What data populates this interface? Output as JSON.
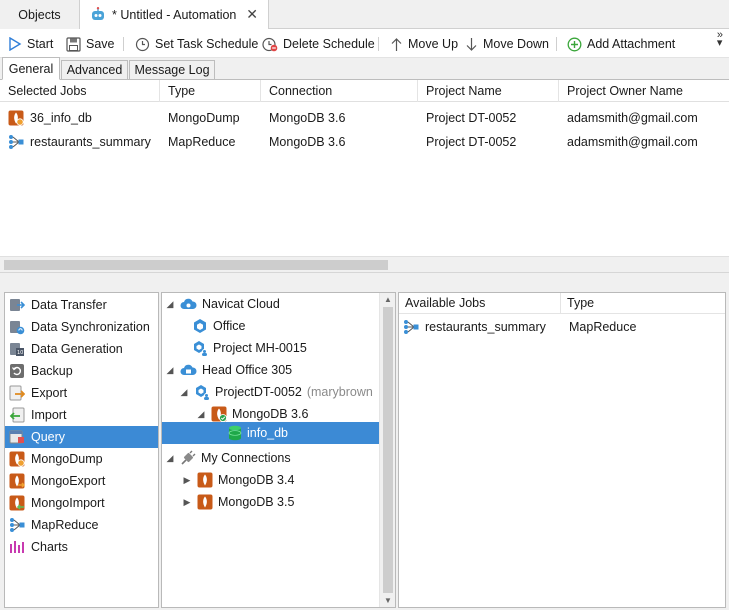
{
  "tabs": {
    "objects": "Objects",
    "automation": "* Untitled - Automation",
    "close": "✕"
  },
  "toolbar": {
    "start": "Start",
    "save": "Save",
    "set_task_schedule": "Set Task Schedule",
    "delete_schedule": "Delete Schedule",
    "move_up": "Move Up",
    "move_down": "Move Down",
    "add_attachment": "Add Attachment"
  },
  "subtabs": [
    "General",
    "Advanced",
    "Message Log"
  ],
  "jobs_table": {
    "columns": [
      "Selected Jobs",
      "Type",
      "Connection",
      "Project Name",
      "Project Owner Name"
    ],
    "rows": [
      {
        "icon": "mongodump-icon",
        "job": "36_info_db",
        "type": "MongoDump",
        "connection": "MongoDB 3.6",
        "project": "Project DT-0052",
        "owner": "adamsmith@gmail.com"
      },
      {
        "icon": "mapreduce-icon",
        "job": "restaurants_summary",
        "type": "MapReduce",
        "connection": "MongoDB 3.6",
        "project": "Project DT-0052",
        "owner": "adamsmith@gmail.com"
      }
    ]
  },
  "job_types": [
    {
      "label": "Data Transfer",
      "icon": "data-transfer-icon"
    },
    {
      "label": "Data Synchronization",
      "icon": "data-sync-icon"
    },
    {
      "label": "Data Generation",
      "icon": "data-generation-icon"
    },
    {
      "label": "Backup",
      "icon": "backup-icon"
    },
    {
      "label": "Export",
      "icon": "export-icon"
    },
    {
      "label": "Import",
      "icon": "import-icon"
    },
    {
      "label": "Query",
      "icon": "query-icon",
      "selected": true
    },
    {
      "label": "MongoDump",
      "icon": "mongodump-icon"
    },
    {
      "label": "MongoExport",
      "icon": "mongoexport-icon"
    },
    {
      "label": "MongoImport",
      "icon": "mongoimport-icon"
    },
    {
      "label": "MapReduce",
      "icon": "mapreduce-icon"
    },
    {
      "label": "Charts",
      "icon": "charts-icon"
    }
  ],
  "tree": {
    "navicat_cloud": "Navicat Cloud",
    "office": "Office",
    "project_mh": "Project MH-0015",
    "head_office": "Head Office 305",
    "project_dt": "ProjectDT-0052",
    "project_dt_owner": "(marybrown",
    "mongodb_36": "MongoDB 3.6",
    "info_db": "info_db",
    "my_connections": "My Connections",
    "mongodb_34": "MongoDB 3.4",
    "mongodb_35": "MongoDB 3.5"
  },
  "available_jobs": {
    "columns": [
      "Available Jobs",
      "Type"
    ],
    "rows": [
      {
        "icon": "mapreduce-icon",
        "job": "restaurants_summary",
        "type": "MapReduce"
      }
    ]
  },
  "colors": {
    "selection": "#3c8ad5",
    "mongo_orange": "#c85a18",
    "cloud_blue": "#3a8fd6",
    "add_green": "#3aa63a"
  }
}
